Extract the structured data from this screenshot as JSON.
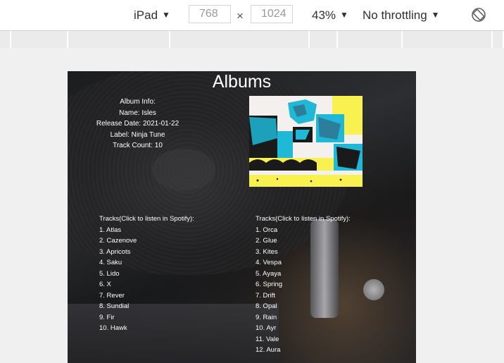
{
  "toolbar": {
    "device": "iPad",
    "width_value": "768",
    "height_value": "1024",
    "dimension_separator": "×",
    "zoom": "43%",
    "throttling": "No throttling"
  },
  "page": {
    "title": "Albums",
    "album_info": {
      "heading": "Album Info:",
      "name": "Name: Isles",
      "release_date": "Release Date: 2021-01-22",
      "label": "Label: Ninja Tune",
      "track_count": "Track Count: 10"
    },
    "track_lists": [
      {
        "header": "Tracks(Click to listen in Spotify):",
        "tracks": [
          "1. Atlas",
          "2. Cazenove",
          "3. Apricots",
          "4. Saku",
          "5. Lido",
          "6. X",
          "7. Rever",
          "8. Sundial",
          "9. Fir",
          "10. Hawk"
        ]
      },
      {
        "header": "Tracks(Click to listen in Spotify):",
        "tracks": [
          "1. Orca",
          "2. Glue",
          "3. Kites",
          "4. Vespa",
          "5. Ayaya",
          "6. Spring",
          "7. Drift",
          "8. Opal",
          "9. Rain",
          "10. Ayr",
          "11. Vale",
          "12. Aura"
        ]
      }
    ]
  },
  "icons": {
    "caret": "caret-down-icon",
    "rotate": "rotate-icon"
  },
  "colors": {
    "cover_cyan": "#1fb8d6",
    "cover_yellow": "#f9f14f",
    "cover_dark": "#1a1a1a",
    "cover_bg": "#f4f0ee"
  }
}
